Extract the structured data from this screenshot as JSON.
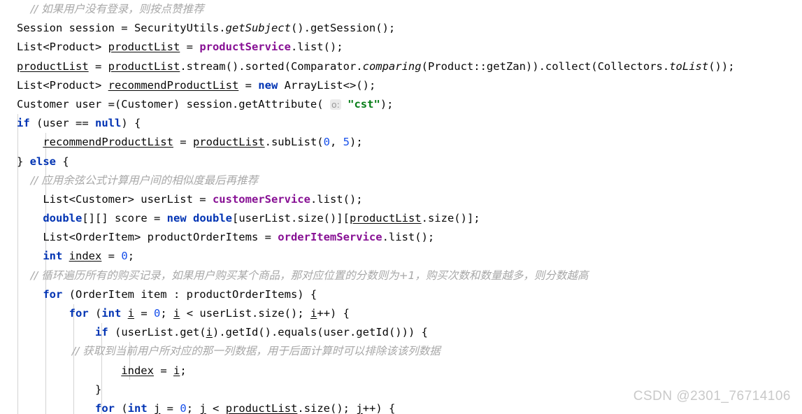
{
  "editor": {
    "language": "java",
    "theme": "IntelliJ Light",
    "colors": {
      "background": "#ffffff",
      "default_text": "#080808",
      "keyword": "#0033b3",
      "number": "#1750eb",
      "string": "#067d17",
      "comment": "#a8a8a8",
      "field": "#871094",
      "indent_guide": "#d4d4d4",
      "inlay_hint_text": "#9a9a9a",
      "inlay_hint_bg": "#ebebeb",
      "watermark": "#c9c9c9"
    },
    "indent_guides_x": [
      25,
      65,
      105,
      145
    ],
    "lines": [
      {
        "n": 1,
        "text": "    // 如果用户没有登录，则按点赞推荐"
      },
      {
        "n": 2,
        "text": "Session session = SecurityUtils.getSubject().getSession();"
      },
      {
        "n": 3,
        "text": "List<Product> productList = productService.list();"
      },
      {
        "n": 4,
        "text": "productList = productList.stream().sorted(Comparator.comparing(Product::getZan)).collect(Collectors.toList());"
      },
      {
        "n": 5,
        "text": "List<Product> recommendProductList = new ArrayList<>();"
      },
      {
        "n": 6,
        "text": "Customer user =(Customer) session.getAttribute( o: \"cst\");"
      },
      {
        "n": 7,
        "text": "if (user == null) {"
      },
      {
        "n": 8,
        "text": "    recommendProductList = productList.subList(0, 5);"
      },
      {
        "n": 9,
        "text": "} else {"
      },
      {
        "n": 10,
        "text": "    // 应用余弦公式计算用户间的相似度最后再推荐"
      },
      {
        "n": 11,
        "text": "    List<Customer> userList = customerService.list();"
      },
      {
        "n": 12,
        "text": "    double[][] score = new double[userList.size()][productList.size()];"
      },
      {
        "n": 13,
        "text": "    List<OrderItem> productOrderItems = orderItemService.list();"
      },
      {
        "n": 14,
        "text": "    int index = 0;"
      },
      {
        "n": 15,
        "text": "    // 循环遍历所有的购买记录，如果用户购买某个商品，那对应位置的分数则为+1，购买次数和数量越多，则分数越高"
      },
      {
        "n": 16,
        "text": "    for (OrderItem item : productOrderItems) {"
      },
      {
        "n": 17,
        "text": "        for (int i = 0; i < userList.size(); i++) {"
      },
      {
        "n": 18,
        "text": "            if (userList.get(i).getId().equals(user.getId())) {"
      },
      {
        "n": 19,
        "text": "                // 获取到当前用户所对应的那一列数据，用于后面计算时可以排除该该列数据"
      },
      {
        "n": 20,
        "text": "                index = i;"
      },
      {
        "n": 21,
        "text": "            }"
      },
      {
        "n": 22,
        "text": "            for (int j = 0; j < productList.size(); j++) {"
      }
    ],
    "inlay_hints": [
      {
        "line": 6,
        "label": "o:"
      }
    ],
    "keywords_used": [
      "new",
      "if",
      "null",
      "else",
      "double",
      "int",
      "for"
    ],
    "fields_used": [
      "productService",
      "customerService",
      "orderItemService"
    ],
    "static_methods_italic": [
      "getSubject",
      "comparing",
      "toList"
    ],
    "local_vars_underlined": [
      "productList",
      "recommendProductList",
      "index",
      "i",
      "j"
    ],
    "strings": [
      "\"cst\""
    ],
    "numbers": [
      "0",
      "5"
    ]
  },
  "watermark": {
    "text": "CSDN @2301_76714106"
  }
}
